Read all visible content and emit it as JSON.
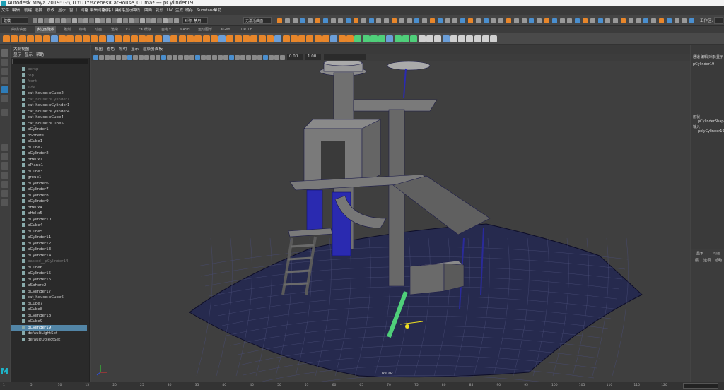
{
  "window": {
    "title": "Autodesk Maya 2019: G:\\UTYUTY\\scenes\\CatHouse_01.ma*   ---   pCylinder19"
  },
  "menubar": {
    "items": [
      "文件",
      "编辑",
      "创建",
      "选择",
      "修改",
      "显示",
      "窗口",
      "网格",
      "编辑网格",
      "网格工具",
      "网格显示",
      "曲线",
      "曲面",
      "变形",
      "UV",
      "生成",
      "缓存",
      "Substance",
      "帮助"
    ],
    "workspace_label": "工作区:"
  },
  "statusline": {
    "mode": "建模",
    "symmetry": "对称: 禁用",
    "live": "无激活曲面"
  },
  "shelf": {
    "tabs": [
      "曲线/曲面",
      "多边形建模",
      "雕刻",
      "绑定",
      "动画",
      "渲染",
      "FX",
      "FX 缓存",
      "自定义",
      "MASH",
      "运动图形",
      "XGen",
      "TURTLE"
    ],
    "active_tab": 1
  },
  "outliner": {
    "menu": [
      "显示",
      "显示",
      "帮助"
    ],
    "title": "大纲视图",
    "items": [
      {
        "label": "persp",
        "dim": true
      },
      {
        "label": "top",
        "dim": true
      },
      {
        "label": "front",
        "dim": true
      },
      {
        "label": "side",
        "dim": true
      },
      {
        "label": "cat_house:pCube2",
        "dim": false
      },
      {
        "label": "cat_house:pCylinder1",
        "dim": true
      },
      {
        "label": "cat_house:pCylinder1",
        "dim": false
      },
      {
        "label": "cat_house:pCylinder4",
        "dim": false
      },
      {
        "label": "cat_house:pCube4",
        "dim": false
      },
      {
        "label": "cat_house:pCube5",
        "dim": false
      },
      {
        "label": "pCylinder1",
        "dim": false
      },
      {
        "label": "pSphere1",
        "dim": false
      },
      {
        "label": "pCube1",
        "dim": false
      },
      {
        "label": "pCube2",
        "dim": false
      },
      {
        "label": "pCylinder2",
        "dim": false
      },
      {
        "label": "pHelix1",
        "dim": false
      },
      {
        "label": "pPlane1",
        "dim": false
      },
      {
        "label": "pCube3",
        "dim": false
      },
      {
        "label": "group1",
        "dim": false
      },
      {
        "label": "pCylinder6",
        "dim": false
      },
      {
        "label": "pCylinder7",
        "dim": false
      },
      {
        "label": "pCylinder8",
        "dim": false
      },
      {
        "label": "pCylinder9",
        "dim": false
      },
      {
        "label": "pHelix4",
        "dim": false
      },
      {
        "label": "pHelix5",
        "dim": false
      },
      {
        "label": "pCylinder10",
        "dim": false
      },
      {
        "label": "pCube4",
        "dim": false
      },
      {
        "label": "pCube5",
        "dim": false
      },
      {
        "label": "pCylinder11",
        "dim": false
      },
      {
        "label": "pCylinder12",
        "dim": false
      },
      {
        "label": "pCylinder13",
        "dim": false
      },
      {
        "label": "pCylinder14",
        "dim": false
      },
      {
        "label": "pasted__pCylinder14",
        "dim": true
      },
      {
        "label": "pCube6",
        "dim": false
      },
      {
        "label": "pCylinder15",
        "dim": false
      },
      {
        "label": "pCylinder16",
        "dim": false
      },
      {
        "label": "pSphere2",
        "dim": false
      },
      {
        "label": "pCylinder17",
        "dim": false
      },
      {
        "label": "cat_house:pCube6",
        "dim": false
      },
      {
        "label": "pCube7",
        "dim": false
      },
      {
        "label": "pCube8",
        "dim": false
      },
      {
        "label": "pCylinder18",
        "dim": false
      },
      {
        "label": "pCube9",
        "dim": false
      },
      {
        "label": "pCylinder19",
        "dim": false,
        "selected": true
      },
      {
        "label": "defaultLightSet",
        "dim": false
      },
      {
        "label": "defaultObjectSet",
        "dim": false
      }
    ]
  },
  "viewport": {
    "menu": [
      "视图",
      "着色",
      "照明",
      "显示",
      "渲染器",
      "面板"
    ],
    "near": "0.00",
    "far": "1.00",
    "camera_label": "persp"
  },
  "channelbox": {
    "tabs": [
      "通道",
      "编辑",
      "对象",
      "显示"
    ],
    "object": "pCylinder19",
    "shapes_label": "形状",
    "shape": "pCylinderShape19",
    "inputs_label": "输入",
    "input": "polyCylinder19",
    "layer_tabs": [
      "显示",
      "动画"
    ],
    "layer_menu": [
      "层",
      "选项",
      "帮助"
    ]
  },
  "timeline": {
    "ticks": [
      "1",
      "5",
      "10",
      "15",
      "20",
      "25",
      "30",
      "35",
      "40",
      "45",
      "50",
      "55",
      "60",
      "65",
      "70",
      "75",
      "80",
      "85",
      "90",
      "95",
      "100",
      "105",
      "110",
      "115",
      "120"
    ],
    "current": "1"
  },
  "colors": {
    "accent_select": "#5285a6",
    "wire": "#1e1e4a",
    "green_manip": "#4fcf7a",
    "yellow_manip": "#f0e020",
    "orange_shelf": "#e8862a"
  }
}
